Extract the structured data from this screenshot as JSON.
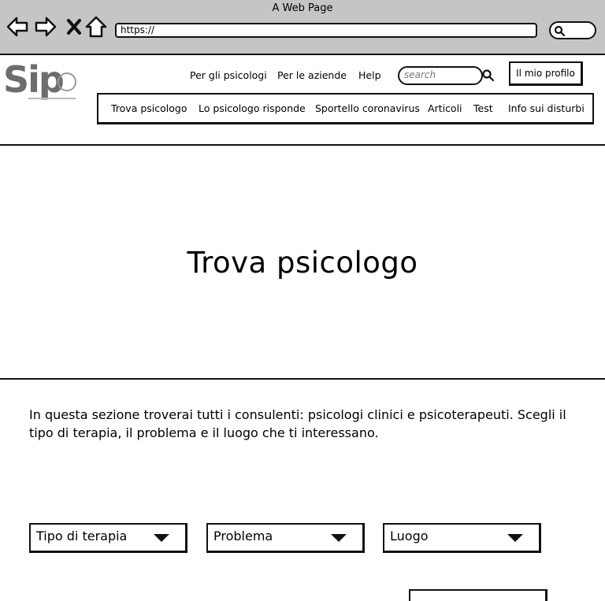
{
  "browser": {
    "title": "A Web Page",
    "url": "https://"
  },
  "header": {
    "logo_text": "Sip",
    "top_links": [
      "Per gli psicologi",
      "Per le aziende",
      "Help"
    ],
    "search_placeholder": "search",
    "profile_label": "Il mio profilo"
  },
  "nav": {
    "items": [
      "Trova psicologo",
      "Lo psicologo risponde",
      "Sportello coronavirus",
      "Articoli",
      "Test",
      "Info sui disturbi"
    ]
  },
  "hero": {
    "title": "Trova psicologo"
  },
  "content": {
    "intro": "In questa sezione troverai tutti i consulenti: psicologi clinici e psicoterapeuti. Scegli il tipo di terapia, il problema e il luogo che ti interessano.",
    "filters": [
      "Tipo di terapia",
      "Problema",
      "Luogo"
    ]
  }
}
